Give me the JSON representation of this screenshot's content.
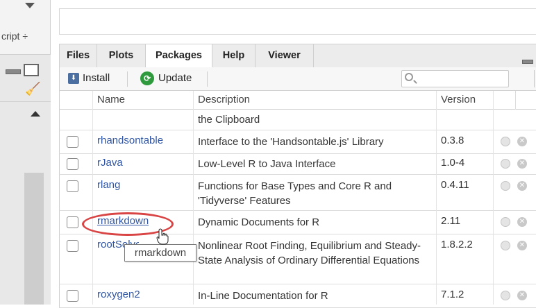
{
  "left": {
    "script_selector": "cript",
    "script_caret": "÷"
  },
  "tabs": [
    {
      "label": "Files",
      "active": false
    },
    {
      "label": "Plots",
      "active": false
    },
    {
      "label": "Packages",
      "active": true
    },
    {
      "label": "Help",
      "active": false
    },
    {
      "label": "Viewer",
      "active": false
    }
  ],
  "toolbar": {
    "install_label": "Install",
    "update_label": "Update",
    "search_placeholder": ""
  },
  "table": {
    "headers": {
      "name": "Name",
      "description": "Description",
      "version": "Version"
    },
    "partial_row_description": "the Clipboard",
    "rows": [
      {
        "name": "rhandsontable",
        "description": "Interface to the 'Handsontable.js' Library",
        "version": "0.3.8"
      },
      {
        "name": "rJava",
        "description": "Low-Level R to Java Interface",
        "version": "1.0-4"
      },
      {
        "name": "rlang",
        "description": "Functions for Base Types and Core R and 'Tidyverse' Features",
        "version": "0.4.11"
      },
      {
        "name": "rmarkdown",
        "description": "Dynamic Documents for R",
        "version": "2.11"
      },
      {
        "name": "rootSolve",
        "description": "Nonlinear Root Finding, Equilibrium and Steady-State Analysis of Ordinary Differential Equations",
        "version": "1.8.2.2"
      },
      {
        "name": "roxygen2",
        "description": "In-Line Documentation for R",
        "version": "7.1.2"
      }
    ]
  },
  "tooltip": {
    "text": "rmarkdown"
  },
  "colors": {
    "link": "#2f55a4",
    "highlight": "#d94444",
    "update_green": "#2e9a3d"
  }
}
